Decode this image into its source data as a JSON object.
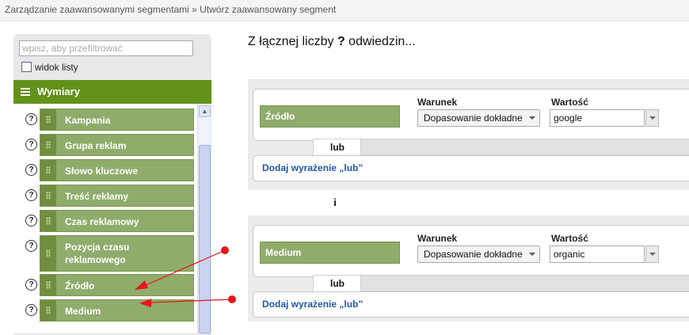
{
  "breadcrumb": "Zarządzanie zaawansowanymi segmentami » Utwórz zaawansowany segment",
  "left_panel": {
    "filter_placeholder": "wpisz, aby przefiltrować",
    "list_view_label": "widok listy",
    "section_title": "Wymiary",
    "help_glyph": "?",
    "items": [
      "Kampania",
      "Grupa reklam",
      "Słowo kluczowe",
      "Treść reklamy",
      "Czas reklamowy",
      "Pozycja czasu reklamowego",
      "Źródło",
      "Medium"
    ]
  },
  "segment": {
    "title_prefix": "Z łącznej liczby",
    "title_q": "?",
    "title_suffix": "odwiedzin...",
    "condition_label": "Warunek",
    "value_label": "Wartość",
    "or_label": "lub",
    "and_label": "i",
    "add_or_label": "Dodaj wyrażenie „lub”",
    "groups": [
      {
        "field": "Źródło",
        "condition": "Dopasowanie dokładne",
        "value": "google"
      },
      {
        "field": "Medium",
        "condition": "Dopasowanie dokładne",
        "value": "organic"
      }
    ]
  },
  "colors": {
    "header_green": "#63921b",
    "chip_green": "#8fac6b",
    "link_blue": "#1f58a6",
    "annotation_red": "#e8141c"
  }
}
